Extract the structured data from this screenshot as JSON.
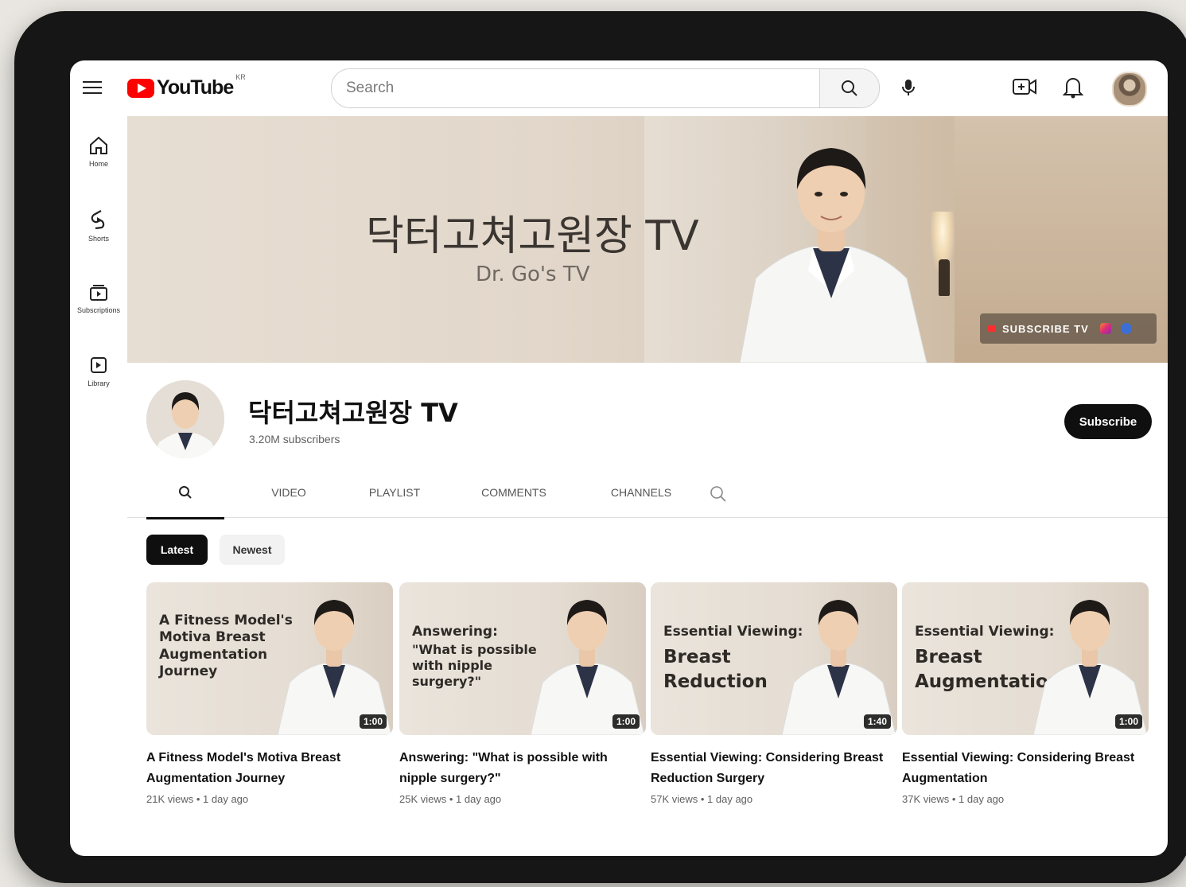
{
  "header": {
    "logo_text": "YouTube",
    "logo_sup": "KR",
    "search_placeholder": "Search"
  },
  "sidebar": {
    "items": [
      {
        "label": "Home",
        "icon": "home-icon"
      },
      {
        "label": "Shorts",
        "icon": "shorts-icon"
      },
      {
        "label": "Subscriptions",
        "icon": "subscriptions-icon"
      },
      {
        "label": "Library",
        "icon": "library-icon"
      }
    ]
  },
  "banner": {
    "title": "닥터고쳐고원장 TV",
    "subtitle": "Dr. Go's TV",
    "social_text": "SUBSCRIBE TV"
  },
  "channel": {
    "name": "닥터고쳐고원장 TV",
    "subscribers": "3.20M subscribers",
    "subscribe_label": "Subscribe"
  },
  "tabs": [
    {
      "label": "VIDEO"
    },
    {
      "label": "PLAYLIST"
    },
    {
      "label": "COMMENTS"
    },
    {
      "label": "CHANNELS"
    }
  ],
  "chips": {
    "latest": "Latest",
    "newest": "Newest"
  },
  "videos": [
    {
      "thumb_text": "A Fitness Model's Motiva Breast Augmentation Journey",
      "duration": "1:00",
      "title": "A Fitness Model's Motiva Breast Augmentation Journey",
      "meta": "21K views • 1 day ago"
    },
    {
      "thumb_kicker": "Answering:",
      "thumb_text": "\"What is possible with nipple surgery?\"",
      "duration": "1:00",
      "title": "Answering: \"What is possible with nipple surgery?\"",
      "meta": "25K views • 1 day ago"
    },
    {
      "thumb_kicker": "Essential Viewing:",
      "thumb_text": "Breast Reduction",
      "duration": "1:40",
      "title": "Essential Viewing: Considering Breast Reduction Surgery",
      "meta": "57K views • 1 day ago"
    },
    {
      "thumb_kicker": "Essential Viewing:",
      "thumb_text": "Breast Augmentation",
      "duration": "1:00",
      "title": "Essential Viewing: Considering Breast Augmentation",
      "meta": "37K views • 1 day ago"
    }
  ],
  "colors": {
    "brand_red": "#ff0000",
    "text_primary": "#0f0f0f",
    "text_secondary": "#606060",
    "banner_beige": "#e2d7ca"
  }
}
